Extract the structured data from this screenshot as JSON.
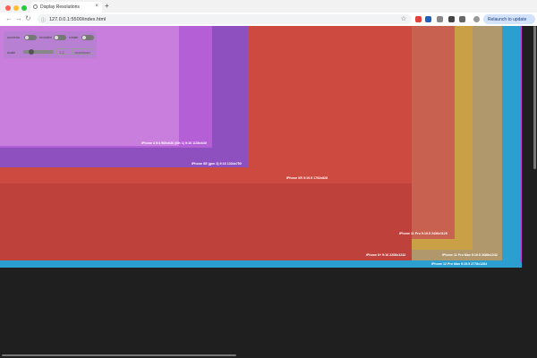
{
  "browser": {
    "tab_title": "Display Resolutions",
    "tab_close": "×",
    "new_tab": "+",
    "url": "127.0.0.1:5500/index.html",
    "relaunch_label": "Relaunch to update",
    "dots": [
      "#ff5f57",
      "#febc2e",
      "#28c840"
    ]
  },
  "controls": {
    "screens_label": "screens",
    "invisible_label": "invisible",
    "rotate_label": "rotate",
    "scale_label": "scale",
    "scale_value": "1.2",
    "download_label": "download"
  },
  "resolutions": [
    {
      "name": "iPhone 12 Pro Max 9:19.5 2778x1284",
      "color": "#2b9fd0"
    },
    {
      "name": "iPhone 8 Plus",
      "color": "#cc3fd3"
    },
    {
      "name": "iPhone 11 Pro Max 9:19.5 2688x1242",
      "color": "#b0986c"
    },
    {
      "name": "iPhone XR",
      "color": "#c9a045"
    },
    {
      "name": "iPhone 11 Pro 9:19.5 2436x1125",
      "color": "#c96150"
    },
    {
      "name": "iPhone 6+ 9:16 2208x1242",
      "color": "#bf413c"
    },
    {
      "name": "iPhone XR 9:19.5 1792x828",
      "color": "#cc4a40"
    },
    {
      "name": "iPhone SE (gen 3) 9:16 1334x750",
      "color": "#8e4fbf"
    },
    {
      "name": "iPhone 5s",
      "color": "#b45fd6"
    },
    {
      "name": "iPhone 4 9:4 960x640 (6th 1) 9:16 1136x640",
      "color": "#c97ede"
    }
  ]
}
